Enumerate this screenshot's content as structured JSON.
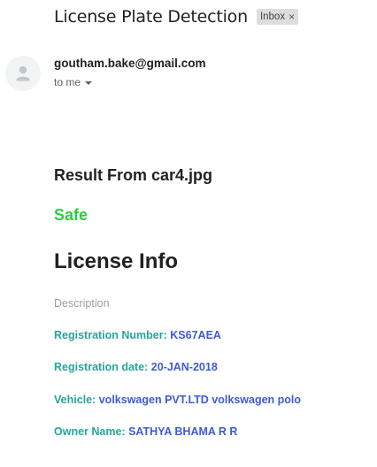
{
  "email": {
    "subject": "License Plate Detection",
    "label_chip": "Inbox",
    "label_chip_close": "×",
    "sender": "goutham.bake@gmail.com",
    "recipient_line": "to me"
  },
  "body": {
    "result_title": "Result From car4.jpg",
    "status": "Safe",
    "info_heading": "License Info",
    "description": "Description",
    "fields": [
      {
        "label": "Registration Number:",
        "value": "KS67AEA"
      },
      {
        "label": "Registration date:",
        "value": "20-JAN-2018"
      },
      {
        "label": "Vehicle:",
        "value": "volkswagen PVT.LTD volkswagen polo"
      },
      {
        "label": "Owner Name:",
        "value": "SATHYA BHAMA R R"
      }
    ]
  },
  "colors": {
    "status_safe": "#2ecc40",
    "field_label": "#26a69a",
    "field_value": "#3f5bd5",
    "chip_bg": "#dddddd"
  },
  "icons": {
    "avatar": "person-icon",
    "recipient_dropdown": "caret-down-icon",
    "chip_close": "close-icon"
  }
}
